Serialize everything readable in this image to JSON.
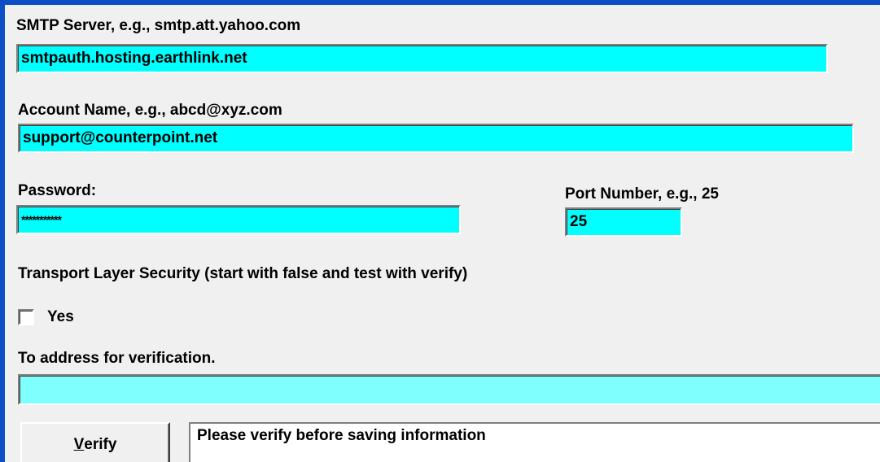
{
  "smtp": {
    "label": "SMTP Server, e.g., smtp.att.yahoo.com",
    "value": "smtpauth.hosting.earthlink.net"
  },
  "account": {
    "label": "Account Name, e.g., abcd@xyz.com",
    "value": "support@counterpoint.net"
  },
  "password": {
    "label": "Password:",
    "value": "***********"
  },
  "port": {
    "label": "Port Number, e.g., 25",
    "value": "25"
  },
  "tls": {
    "label": "Transport Layer Security (start with false and test with verify)",
    "checkbox_label": "Yes",
    "checked": false
  },
  "verify_address": {
    "label": "To address for verification.",
    "value": ""
  },
  "verify_button": {
    "accel": "V",
    "rest": "erify"
  },
  "status": {
    "text": "Please verify before saving information"
  },
  "colors": {
    "title_border": "#0a4fc4",
    "field_bg": "#00ffff",
    "field_bg_light": "#80ffff",
    "panel_bg": "#f0f0f0"
  }
}
